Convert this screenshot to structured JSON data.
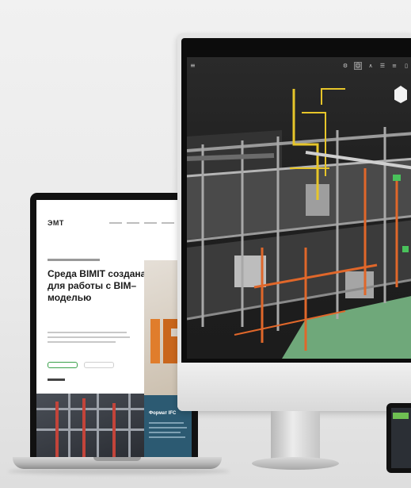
{
  "laptop_site": {
    "logo": "ЭМТ",
    "hero_title": "Среда BIMIT создана для работы с BIM–моделью",
    "promo_title": "Формат IFC"
  },
  "colors": {
    "laptop_body": "#111111",
    "site_accent": "#3aa14a",
    "promo_bg": "#2c5a72",
    "ifc_orange": "#e07d2c",
    "model_yellow": "#e6c52a",
    "model_orange": "#e0672a",
    "model_green": "#6fa87a"
  },
  "viewer": {
    "menu_icon": "hamburger-icon",
    "toolbar_icons": [
      "settings-icon",
      "person-icon",
      "measure-icon",
      "list-icon",
      "sliders-icon",
      "layers-icon"
    ],
    "viewcube_icon": "viewcube-icon"
  }
}
